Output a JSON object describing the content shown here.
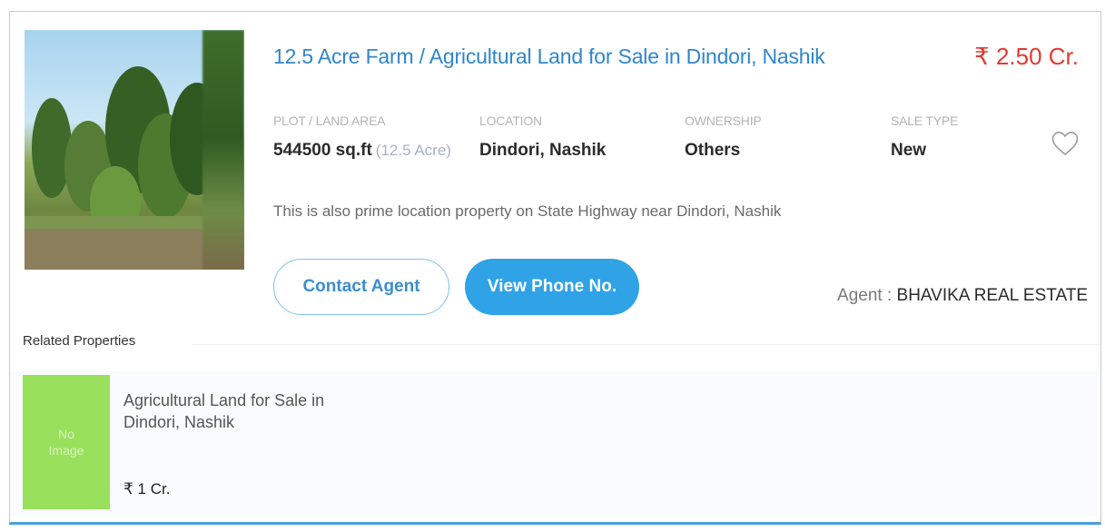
{
  "listing": {
    "title": "12.5 Acre Farm / Agricultural Land for Sale in Dindori, Nashik",
    "price": "₹ 2.50 Cr.",
    "details": {
      "plot_area_label": "PLOT / LAND AREA",
      "plot_area_value": "544500 sq.ft",
      "plot_area_sub": "(12.5 Acre)",
      "location_label": "LOCATION",
      "location_value": "Dindori, Nashik",
      "ownership_label": "OWNERSHIP",
      "ownership_value": "Others",
      "sale_type_label": "SALE TYPE",
      "sale_type_value": "New"
    },
    "description": "This is also prime location property on State Highway near Dindori, Nashik",
    "contact_button": "Contact Agent",
    "phone_button": "View Phone No.",
    "agent_label": "Agent : ",
    "agent_name": "BHAVIKA REAL ESTATE",
    "favorite_icon": "heart-outline-icon"
  },
  "related": {
    "heading": "Related Properties",
    "items": [
      {
        "placeholder_line1": "No",
        "placeholder_line2": "Image",
        "name": "Agricultural Land for Sale in Dindori, Nashik",
        "price": "₹ 1 Cr."
      }
    ]
  },
  "colors": {
    "title": "#2f86cc",
    "price": "#e23a33",
    "primary_button": "#2fa3e6",
    "no_image_bg": "#99e05c"
  }
}
